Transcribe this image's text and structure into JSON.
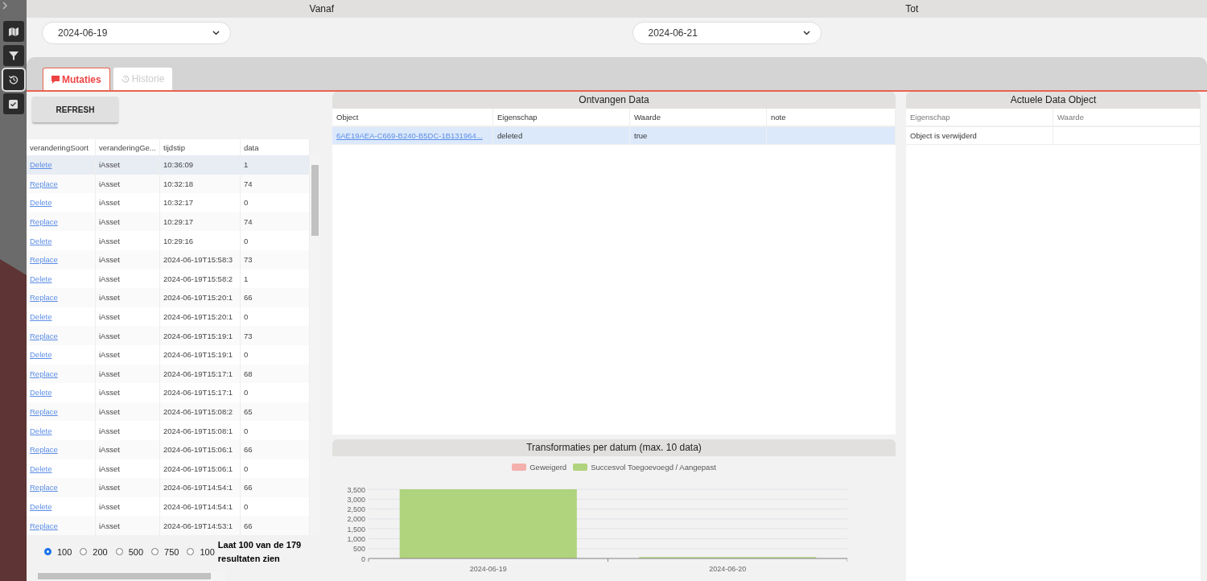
{
  "date_range": {
    "from": {
      "label": "Vanaf",
      "value": "2024-06-19"
    },
    "to": {
      "label": "Tot",
      "value": "2024-06-21"
    }
  },
  "sidebar": {
    "items": [
      {
        "kind": "map",
        "selected": false
      },
      {
        "kind": "filter",
        "selected": false
      },
      {
        "kind": "history",
        "selected": true
      },
      {
        "kind": "check",
        "selected": false
      }
    ]
  },
  "tabs": [
    {
      "label": "Mutaties",
      "kind": "comment",
      "selected": true
    },
    {
      "label": "Historie",
      "kind": "history",
      "selected": false
    }
  ],
  "refresh_button": "REFRESH",
  "mutations_table": {
    "columns": [
      "veranderingSoort",
      "veranderingGe...",
      "tijdstip",
      "data"
    ],
    "rows": [
      {
        "type": "Delete",
        "object": "iAsset",
        "time": "10:36:09",
        "data": "1",
        "selected": true
      },
      {
        "type": "Replace",
        "object": "iAsset",
        "time": "10:32:18",
        "data": "74",
        "selected": false
      },
      {
        "type": "Delete",
        "object": "iAsset",
        "time": "10:32:17",
        "data": "0",
        "selected": false
      },
      {
        "type": "Replace",
        "object": "iAsset",
        "time": "10:29:17",
        "data": "74",
        "selected": false
      },
      {
        "type": "Delete",
        "object": "iAsset",
        "time": "10:29:16",
        "data": "0",
        "selected": false
      },
      {
        "type": "Replace",
        "object": "iAsset",
        "time": "2024-06-19T15:58:3",
        "data": "73",
        "selected": false
      },
      {
        "type": "Delete",
        "object": "iAsset",
        "time": "2024-06-19T15:58:2",
        "data": "1",
        "selected": false
      },
      {
        "type": "Replace",
        "object": "iAsset",
        "time": "2024-06-19T15:20:1",
        "data": "66",
        "selected": false
      },
      {
        "type": "Delete",
        "object": "iAsset",
        "time": "2024-06-19T15:20:1",
        "data": "0",
        "selected": false
      },
      {
        "type": "Replace",
        "object": "iAsset",
        "time": "2024-06-19T15:19:1",
        "data": "73",
        "selected": false
      },
      {
        "type": "Delete",
        "object": "iAsset",
        "time": "2024-06-19T15:19:1",
        "data": "0",
        "selected": false
      },
      {
        "type": "Replace",
        "object": "iAsset",
        "time": "2024-06-19T15:17:1",
        "data": "68",
        "selected": false
      },
      {
        "type": "Delete",
        "object": "iAsset",
        "time": "2024-06-19T15:17:1",
        "data": "0",
        "selected": false
      },
      {
        "type": "Replace",
        "object": "iAsset",
        "time": "2024-06-19T15:08:2",
        "data": "65",
        "selected": false
      },
      {
        "type": "Delete",
        "object": "iAsset",
        "time": "2024-06-19T15:08:1",
        "data": "0",
        "selected": false
      },
      {
        "type": "Replace",
        "object": "iAsset",
        "time": "2024-06-19T15:06:1",
        "data": "66",
        "selected": false
      },
      {
        "type": "Delete",
        "object": "iAsset",
        "time": "2024-06-19T15:06:1",
        "data": "0",
        "selected": false
      },
      {
        "type": "Replace",
        "object": "iAsset",
        "time": "2024-06-19T14:54:1",
        "data": "66",
        "selected": false
      },
      {
        "type": "Delete",
        "object": "iAsset",
        "time": "2024-06-19T14:54:1",
        "data": "0",
        "selected": false
      },
      {
        "type": "Replace",
        "object": "iAsset",
        "time": "2024-06-19T14:53:1",
        "data": "66",
        "selected": false
      }
    ]
  },
  "page_size": {
    "options": [
      {
        "label": "100",
        "selected": true
      },
      {
        "label": "200",
        "selected": false
      },
      {
        "label": "500",
        "selected": false
      },
      {
        "label": "750",
        "selected": false
      },
      {
        "label": "100",
        "selected": false
      }
    ],
    "summary": "Laat 100 van de 179 resultaten zien"
  },
  "received_data": {
    "title": "Ontvangen Data",
    "columns": [
      "Object",
      "Eigenschap",
      "Waarde",
      "note"
    ],
    "rows": [
      {
        "object": "6AE19AEA-C669-B240-B5DC-1B131964...",
        "property": "deleted",
        "value": "true",
        "note": "",
        "selected": true
      }
    ]
  },
  "chart_panel": {
    "title": "Transformaties per datum (max. 10 data)",
    "chart_data": {
      "type": "bar",
      "categories": [
        "2024-06-19",
        "2024-06-20"
      ],
      "stacked": true,
      "grid": true,
      "series": [
        {
          "name": "Geweigerd",
          "color": "#f4b0ab",
          "values": [
            0,
            0
          ]
        },
        {
          "name": "Succesvol Toegoevoegd / Aangepast",
          "color": "#b0d37d",
          "values": [
            3500,
            70
          ]
        }
      ],
      "ylim": [
        0,
        3500
      ],
      "yticks": [
        {
          "value": 0,
          "label": "0"
        },
        {
          "value": 500,
          "label": "500"
        },
        {
          "value": 1000,
          "label": "1,000"
        },
        {
          "value": 1500,
          "label": "1,500"
        },
        {
          "value": 2000,
          "label": "2,000"
        },
        {
          "value": 2500,
          "label": "2,500"
        },
        {
          "value": 3000,
          "label": "3,000"
        },
        {
          "value": 3500,
          "label": "3,500"
        }
      ]
    }
  },
  "current_object": {
    "title": "Actuele Data Object",
    "columns": [
      "Eigenschap",
      "Waarde"
    ],
    "rows": [
      {
        "property": "Object is verwijderd",
        "value": ""
      }
    ]
  }
}
